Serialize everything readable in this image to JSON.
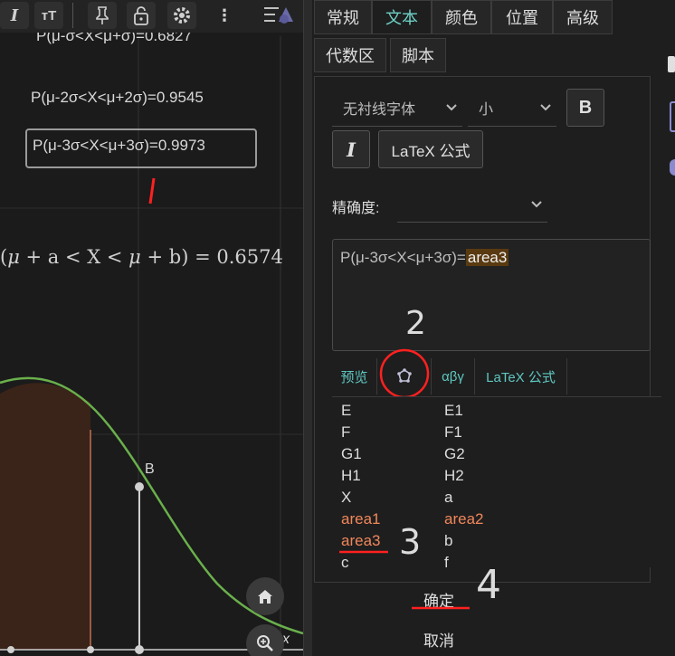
{
  "toolbar": {
    "italic_icon": "I",
    "text_size_icon": "тT",
    "pin_icon": "pin",
    "lock_icon": "lock",
    "settings_icon": "gear",
    "more_icon": "⋮",
    "style_icon": "style"
  },
  "graphics": {
    "text1": "P(μ-σ<X<μ+σ)=0.6827",
    "text2": "P(μ-2σ<X<μ+2σ)=0.9545",
    "text3": "P(μ-3σ<X<μ+3σ)=0.9973",
    "formula_open": "(",
    "formula_mu1": "μ",
    "formula_plus1": " + a < X < ",
    "formula_mu2": "μ",
    "formula_rest": " + b) = 0.6574",
    "point_label": "B",
    "axis_label": "x",
    "annotation_1": "1",
    "home_icon": "home",
    "zoom_icon": "zoom"
  },
  "colors": {
    "curve": "#6ab04c",
    "shaded_fill": "#3a2318",
    "accent": "#6fd0c6",
    "annotation": "#ff2020",
    "highlight_object": "#f0875a"
  },
  "tabs": [
    "常规",
    "文本",
    "颜色",
    "位置",
    "高级",
    "代数区",
    "脚本"
  ],
  "text_panel": {
    "font_select": "无衬线字体",
    "size_select": "小",
    "bold_label": "B",
    "italic_label": "I",
    "latex_button": "LaTeX 公式",
    "precision_label": "精确度:",
    "precision_value": "",
    "editor_static": "P(μ-3σ<X<μ+3σ)=",
    "editor_dynamic": "area3",
    "subtabs": [
      "预览",
      "αβγ",
      "LaTeX 公式"
    ],
    "annotation_2": "2",
    "annotation_3": "3",
    "annotation_4": "4"
  },
  "objects_list": {
    "col1": [
      "E",
      "F",
      "G1",
      "H1",
      "X",
      "area1",
      "area3",
      "c"
    ],
    "col2": [
      "E1",
      "F1",
      "G2",
      "H2",
      "a",
      "area2",
      "b",
      "f"
    ],
    "highlighted": [
      "area1",
      "area2",
      "area3"
    ]
  },
  "buttons": {
    "ok": "确定",
    "cancel": "取消"
  }
}
